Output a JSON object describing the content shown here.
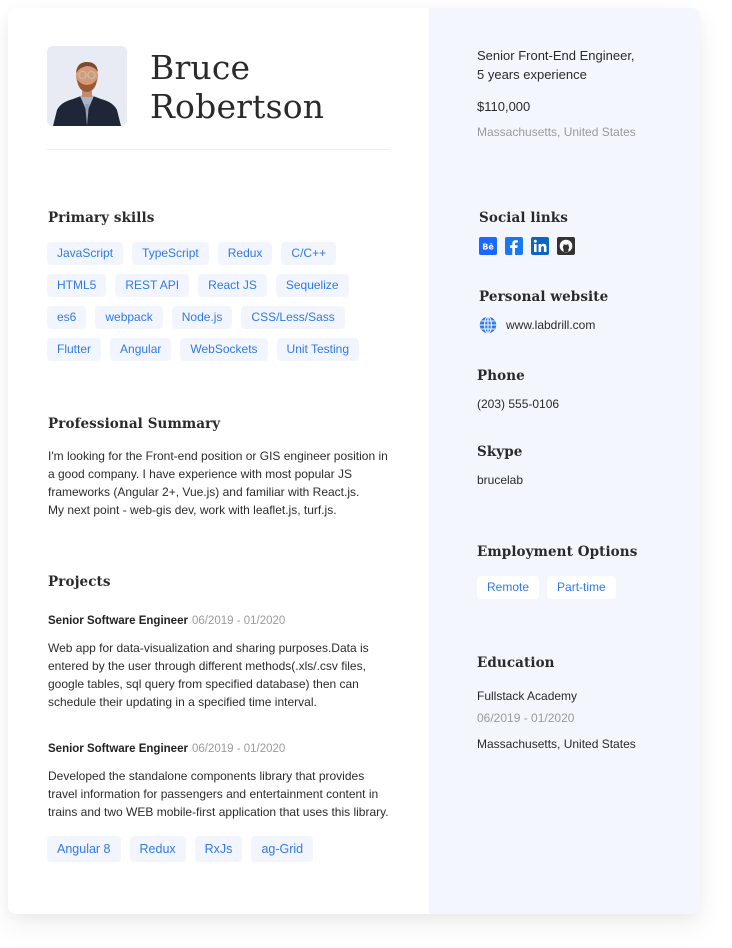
{
  "profile": {
    "first_name": "Bruce",
    "last_name": "Robertson",
    "avatar_alt": "Portrait photo of Bruce Robertson",
    "title_line1": "Senior Front-End Engineer,",
    "title_line2": "5 years experience",
    "salary": "$110,000",
    "location": "Massachusetts, United States"
  },
  "primary_skills": {
    "heading": "Primary skills",
    "items": [
      "JavaScript",
      "TypeScript",
      "Redux",
      "C/C++",
      "HTML5",
      "REST API",
      "React JS",
      "Sequelize",
      "es6",
      "webpack",
      "Node.js",
      "CSS/Less/Sass",
      "Flutter",
      "Angular",
      "WebSockets",
      "Unit Testing"
    ]
  },
  "summary": {
    "heading": "Professional Summary",
    "lines": [
      "I'm looking for the Front-end position or GIS engineer position in",
      "a good company. I have experience with most popular JS",
      "frameworks (Angular 2+, Vue.js) and familiar with React.js.",
      "My next point - web-gis dev, work with leaflet.js, turf.js."
    ]
  },
  "projects": {
    "heading": "Projects",
    "items": [
      {
        "role": "Senior Software Engineer",
        "dates": "06/2019 - 01/2020",
        "lines": [
          "Web app for data-visualization and sharing purposes.Data is",
          "entered by the user through different methods(.xls/.csv files,",
          "google tables, sql query from specified database) then can",
          "schedule their updating in a specified time interval."
        ]
      },
      {
        "role": "Senior Software Engineer",
        "dates": "06/2019 - 01/2020",
        "lines": [
          "Developed the standalone components library that provides",
          "travel information for passengers and entertainment content in",
          "trains and two WEB mobile-first application that uses this library."
        ],
        "tags": [
          "Angular 8",
          "Redux",
          "RxJs",
          "ag-Grid"
        ]
      }
    ]
  },
  "social": {
    "heading": "Social links",
    "links": [
      {
        "name": "behance-icon",
        "glyph": "Bē",
        "color": "#1769ff"
      },
      {
        "name": "facebook-icon",
        "glyph": "f",
        "color": "#1877f2"
      },
      {
        "name": "linkedin-icon",
        "glyph": "in",
        "color": "#0a66c2"
      },
      {
        "name": "github-icon",
        "glyph": "",
        "color": "#333333"
      }
    ]
  },
  "website": {
    "heading": "Personal website",
    "url": "www.labdrill.com"
  },
  "phone": {
    "heading": "Phone",
    "value": "(203) 555-0106"
  },
  "skype": {
    "heading": "Skype",
    "value": "brucelab"
  },
  "employment": {
    "heading": "Employment Options",
    "options": [
      "Remote",
      "Part-time"
    ]
  },
  "education": {
    "heading": "Education",
    "school": "Fullstack Academy",
    "dates": "06/2019 - 01/2020",
    "location": "Massachusetts, United States"
  },
  "colors": {
    "accent": "#2f7ae5",
    "tag_bg": "#f2f5fd",
    "side_panel_bg": "#f3f6fd"
  }
}
